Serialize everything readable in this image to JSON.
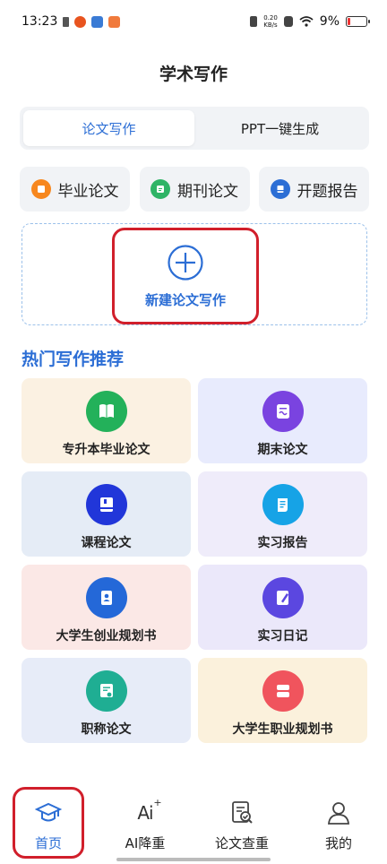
{
  "status_bar": {
    "time": "13:23",
    "net_speed": "0.20",
    "net_unit": "KB/s",
    "battery": "9%"
  },
  "header": {
    "title": "学术写作"
  },
  "segment": {
    "tabs": [
      {
        "label": "论文写作",
        "active": true
      },
      {
        "label": "PPT一键生成",
        "active": false
      }
    ]
  },
  "quick": {
    "items": [
      {
        "label": "毕业论文",
        "color": "#f7871e"
      },
      {
        "label": "期刊论文",
        "color": "#2fb466"
      },
      {
        "label": "开题报告",
        "color": "#2c6ed5"
      }
    ]
  },
  "new_paper": {
    "label": "新建论文写作"
  },
  "hot": {
    "title": "热门写作推荐",
    "cards": [
      {
        "label": "专升本毕业论文",
        "bg": "#fbf1e2",
        "icon_color": "#23b15a",
        "icon": "book-icon"
      },
      {
        "label": "期末论文",
        "bg": "#e8ebfd",
        "icon_color": "#7a43e0",
        "icon": "document-icon"
      },
      {
        "label": "课程论文",
        "bg": "#e5ecf6",
        "icon_color": "#2136d9",
        "icon": "notebook-icon"
      },
      {
        "label": "实习报告",
        "bg": "#efecfa",
        "icon_color": "#16a3e6",
        "icon": "scroll-icon"
      },
      {
        "label": "大学生创业规划书",
        "bg": "#fbe8e6",
        "icon_color": "#2468d8",
        "icon": "contacts-icon"
      },
      {
        "label": "实习日记",
        "bg": "#ebe8fa",
        "icon_color": "#5b47e0",
        "icon": "pen-notebook-icon"
      },
      {
        "label": "职称论文",
        "bg": "#e7ecf8",
        "icon_color": "#1fae93",
        "icon": "certificate-icon"
      },
      {
        "label": "大学生职业规划书",
        "bg": "#fbf1dc",
        "icon_color": "#f0545d",
        "icon": "planner-icon"
      }
    ]
  },
  "tabbar": {
    "tabs": [
      {
        "label": "首页",
        "active": true,
        "icon": "graduation-cap-icon"
      },
      {
        "label": "AI降重",
        "active": false,
        "icon": "ai-sparkle-icon"
      },
      {
        "label": "论文查重",
        "active": false,
        "icon": "doc-check-icon"
      },
      {
        "label": "我的",
        "active": false,
        "icon": "user-icon"
      }
    ]
  },
  "colors": {
    "accent": "#2c6ed5",
    "highlight": "#d11f2b"
  }
}
